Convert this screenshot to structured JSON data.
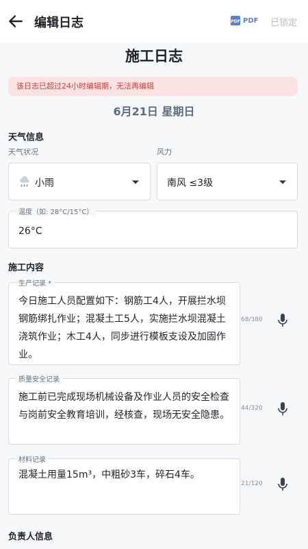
{
  "app_bar": {
    "title": "编辑日志",
    "pdf_label": "PDF",
    "locked_label": "已锁定"
  },
  "page_title": "施工日志",
  "warning": "该日志已超过24小时编辑期，无法再编辑",
  "date": "6月21日 星期日",
  "weather": {
    "section_title": "天气信息",
    "condition_label": "天气状况",
    "condition_value": "小雨",
    "condition_icon": "light-rain-icon",
    "wind_label": "风力",
    "wind_value": "南风 ≤3级",
    "temp_label": "温度（如: 28°C/15°C）",
    "temp_value": "26°C"
  },
  "construction": {
    "section_title": "施工内容",
    "production": {
      "label": "生产记录 *",
      "text": "今日施工人员配置如下：钢筋工4人，开展拦水坝钢筋绑扎作业；混凝土工5人，实施拦水坝混凝土浇筑作业；木工4人，同步进行模板支设及加固作业。",
      "counter": "68/380"
    },
    "quality": {
      "label": "质量安全记录",
      "text": "施工前已完成现场机械设备及作业人员的安全检查与岗前安全教育培训，经核查，现场无安全隐患。",
      "counter": "44/320"
    },
    "material": {
      "label": "材料记录",
      "text": "混凝土用量15m³，中粗砂3车，碎石4车。",
      "counter": "21/120"
    }
  },
  "responsible": {
    "section_title": "负责人信息"
  },
  "colors": {
    "accent": "#5b7fd0",
    "warning_bg": "#fbe3e3",
    "warning_text": "#d83a3a",
    "date_text": "#5b6b83"
  }
}
